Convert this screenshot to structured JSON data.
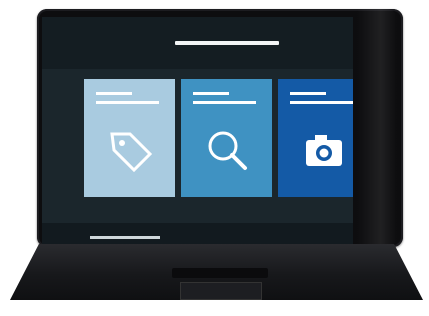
{
  "scene": {
    "device": "tablet-keyboard",
    "colors": {
      "bezel": "#0d0d0f",
      "screen": "#1b262c",
      "tile_light": "#a9cbe0",
      "tile_mid": "#3f92c2",
      "tile_dark": "#145aa6"
    }
  },
  "tiles": [
    {
      "icon": "tag-icon",
      "label": ""
    },
    {
      "icon": "magnifier-icon",
      "label": ""
    },
    {
      "icon": "camera-icon",
      "label": ""
    }
  ]
}
